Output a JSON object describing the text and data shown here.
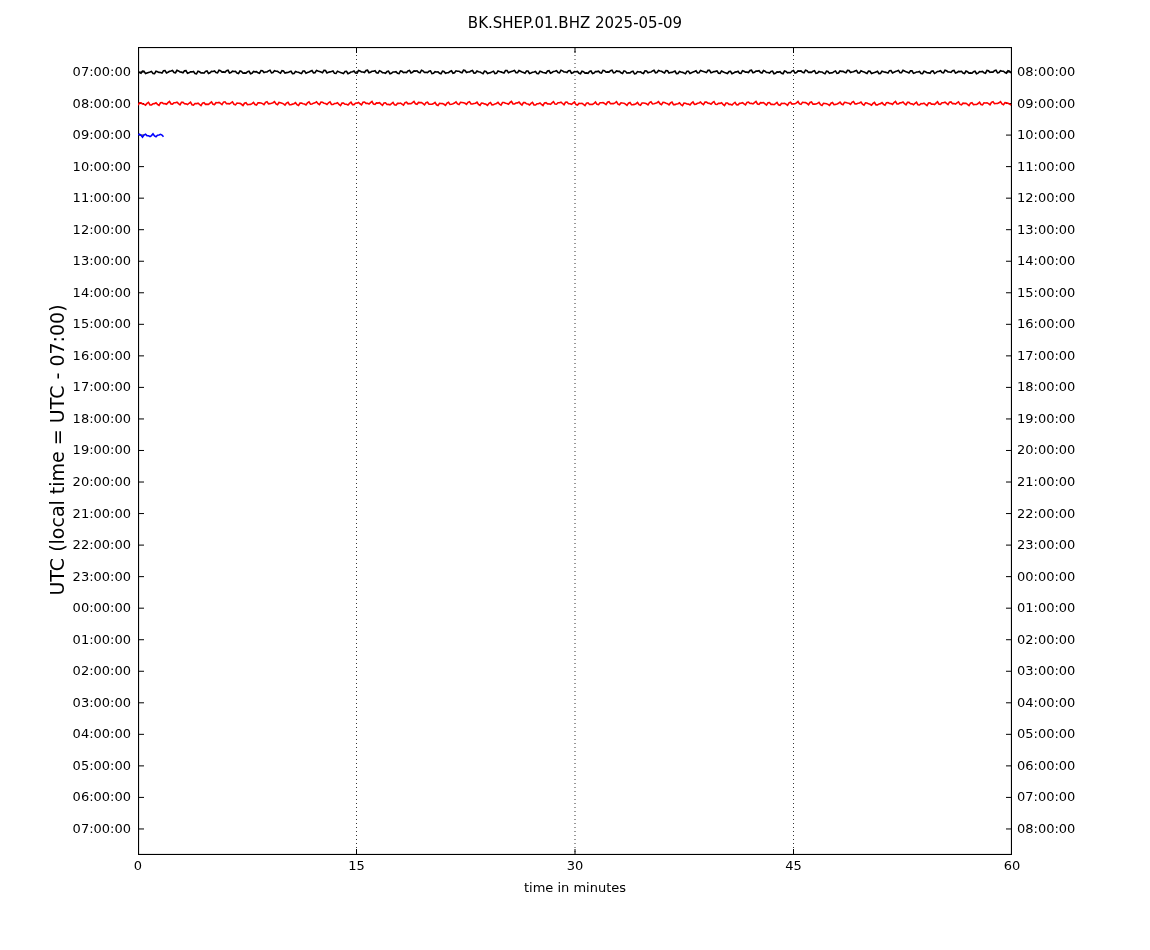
{
  "title": "BK.SHEP.01.BHZ 2025-05-09",
  "ylabel": "UTC (local time = UTC - 07:00)",
  "xlabel": "time in minutes",
  "xticks": [
    "0",
    "15",
    "30",
    "45",
    "60"
  ],
  "rows": [
    {
      "left": "07:00:00",
      "right": "08:00:00"
    },
    {
      "left": "08:00:00",
      "right": "09:00:00"
    },
    {
      "left": "09:00:00",
      "right": "10:00:00"
    },
    {
      "left": "10:00:00",
      "right": "11:00:00"
    },
    {
      "left": "11:00:00",
      "right": "12:00:00"
    },
    {
      "left": "12:00:00",
      "right": "13:00:00"
    },
    {
      "left": "13:00:00",
      "right": "14:00:00"
    },
    {
      "left": "14:00:00",
      "right": "15:00:00"
    },
    {
      "left": "15:00:00",
      "right": "16:00:00"
    },
    {
      "left": "16:00:00",
      "right": "17:00:00"
    },
    {
      "left": "17:00:00",
      "right": "18:00:00"
    },
    {
      "left": "18:00:00",
      "right": "19:00:00"
    },
    {
      "left": "19:00:00",
      "right": "20:00:00"
    },
    {
      "left": "20:00:00",
      "right": "21:00:00"
    },
    {
      "left": "21:00:00",
      "right": "22:00:00"
    },
    {
      "left": "22:00:00",
      "right": "23:00:00"
    },
    {
      "left": "23:00:00",
      "right": "00:00:00"
    },
    {
      "left": "00:00:00",
      "right": "01:00:00"
    },
    {
      "left": "01:00:00",
      "right": "02:00:00"
    },
    {
      "left": "02:00:00",
      "right": "03:00:00"
    },
    {
      "left": "03:00:00",
      "right": "04:00:00"
    },
    {
      "left": "04:00:00",
      "right": "05:00:00"
    },
    {
      "left": "05:00:00",
      "right": "06:00:00"
    },
    {
      "left": "06:00:00",
      "right": "07:00:00"
    },
    {
      "left": "07:00:00",
      "right": "08:00:00"
    }
  ],
  "traces": [
    {
      "color": "#000000",
      "level": 1
    },
    {
      "color": "#ff0000",
      "level": 1
    },
    {
      "color": "#0000ff",
      "level": 0.03
    }
  ]
}
